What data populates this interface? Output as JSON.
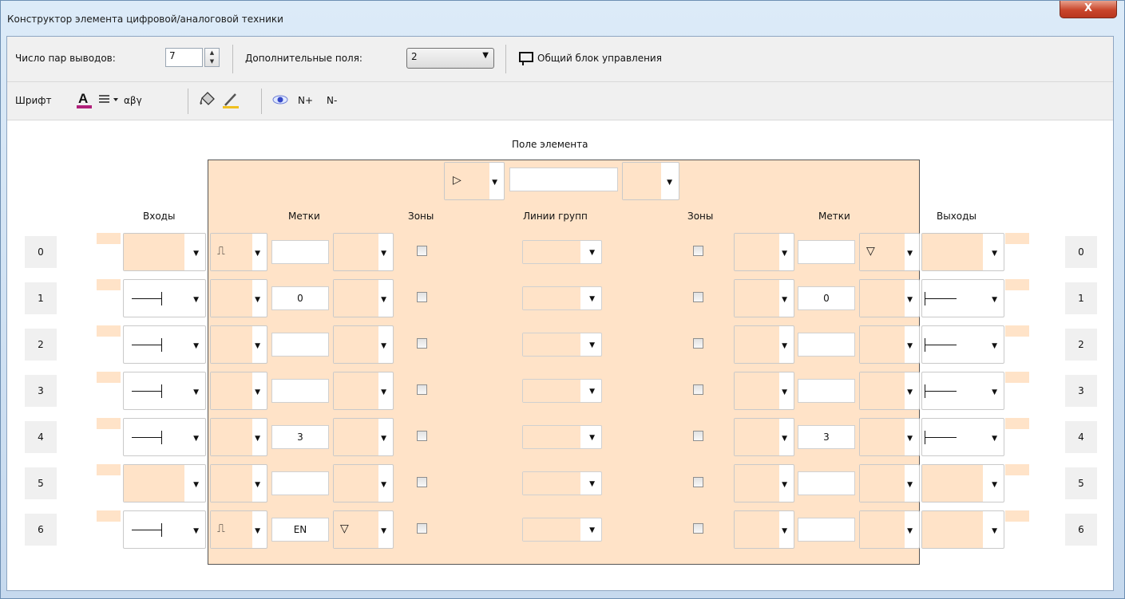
{
  "window": {
    "title": "Конструктор элемента цифровой/аналоговой техники",
    "close_label": "X"
  },
  "toolbar1": {
    "pairs_label": "Число пар выводов:",
    "pairs_value": "7",
    "extra_fields_label": "Дополнительные поля:",
    "extra_fields_value": "2",
    "common_block_label": "Общий блок управления"
  },
  "toolbar2": {
    "font_label": "Шрифт",
    "greek_label": "αβγ",
    "n_plus_label": "N+",
    "n_minus_label": "N-"
  },
  "headers": {
    "element_field": "Поле элемента",
    "inputs": "Входы",
    "labels_left": "Метки",
    "zones_left": "Зоны",
    "group_lines": "Линии групп",
    "zones_right": "Зоны",
    "labels_right": "Метки",
    "outputs": "Выходы"
  },
  "top_controls": {
    "type_glyph": "▷"
  },
  "rows": [
    {
      "num": "0",
      "input_pin": false,
      "left_sym": "⎍",
      "left_label": "",
      "left_mod": "",
      "right_label": "",
      "right_mod": "▽",
      "output_pin": false
    },
    {
      "num": "1",
      "input_pin": true,
      "left_sym": "",
      "left_label": "0",
      "left_mod": "",
      "right_label": "0",
      "right_mod": "",
      "output_pin": true
    },
    {
      "num": "2",
      "input_pin": true,
      "left_sym": "",
      "left_label": "",
      "left_mod": "",
      "right_label": "",
      "right_mod": "",
      "output_pin": true
    },
    {
      "num": "3",
      "input_pin": true,
      "left_sym": "",
      "left_label": "",
      "left_mod": "",
      "right_label": "",
      "right_mod": "",
      "output_pin": true
    },
    {
      "num": "4",
      "input_pin": true,
      "left_sym": "",
      "left_label": "3",
      "left_mod": "",
      "right_label": "3",
      "right_mod": "",
      "output_pin": true
    },
    {
      "num": "5",
      "input_pin": false,
      "left_sym": "",
      "left_label": "",
      "left_mod": "",
      "right_label": "",
      "right_mod": "",
      "output_pin": false
    },
    {
      "num": "6",
      "input_pin": true,
      "left_sym": "⎍",
      "left_label": "EN",
      "left_mod": "▽",
      "right_label": "",
      "right_mod": "",
      "output_pin": false
    }
  ],
  "colors": {
    "field": "#ffe3c8",
    "toolbar": "#f0f0f0"
  }
}
